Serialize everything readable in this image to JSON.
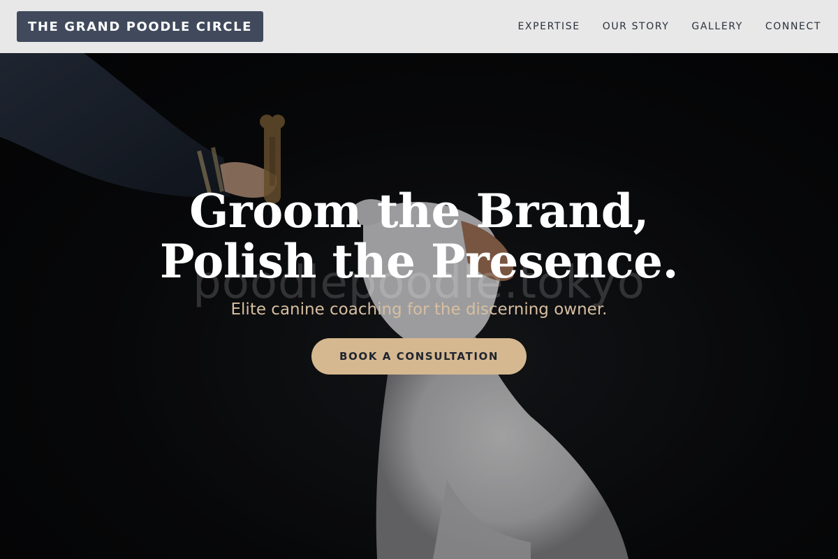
{
  "header": {
    "brand": "THE GRAND POODLE CIRCLE",
    "nav": [
      {
        "label": "EXPERTISE"
      },
      {
        "label": "OUR STORY"
      },
      {
        "label": "GALLERY"
      },
      {
        "label": "CONNECT"
      }
    ]
  },
  "hero": {
    "headline": "Groom the Brand, Polish the Presence.",
    "subheadline": "Elite canine coaching for the discerning owner.",
    "cta_label": "BOOK A CONSULTATION",
    "watermark": "poodlepoodle.tokyo"
  },
  "colors": {
    "nav_background": "#e8e8e8",
    "brand_background": "#404a5c",
    "accent_tan": "#d6b890",
    "subheadline_color": "#d7bfa0"
  }
}
